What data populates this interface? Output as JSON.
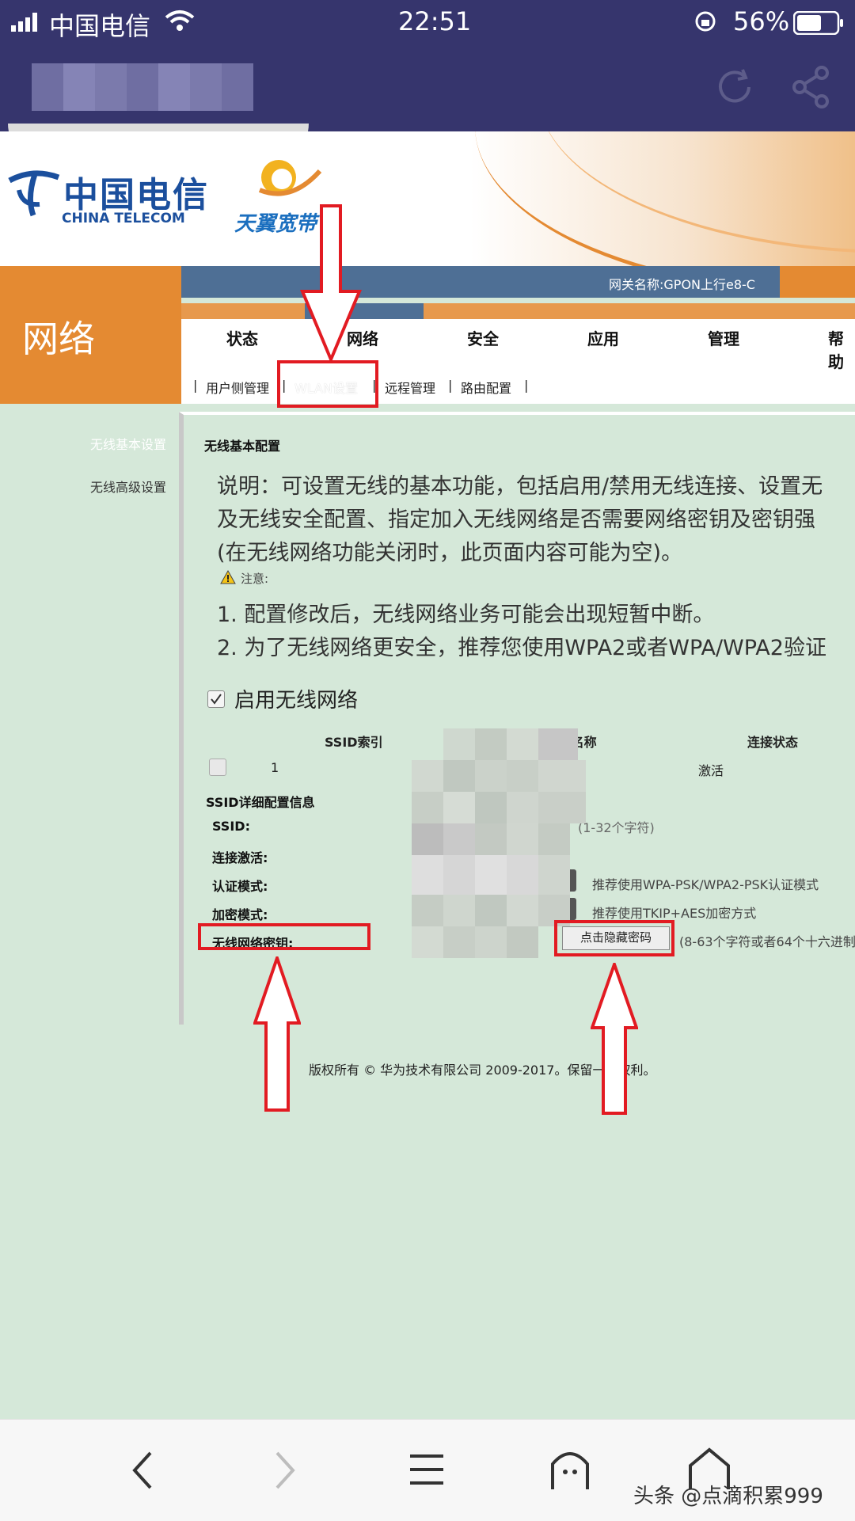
{
  "status_bar": {
    "carrier": "中国电信",
    "time": "22:51",
    "battery": "56%"
  },
  "router": {
    "brand_cn": "中国电信",
    "brand_en": "CHINA TELECOM",
    "sub_brand": "天翼宽带",
    "gateway_name": "网关名称:GPON上行e8-C",
    "section_title": "网络",
    "nav_tabs": [
      "状态",
      "网络",
      "安全",
      "应用",
      "管理",
      "帮助"
    ],
    "sub_nav": [
      "用户侧管理",
      "WLAN设置",
      "远程管理",
      "路由配置"
    ],
    "sub_sep": "|"
  },
  "sidebar": {
    "items": [
      "无线基本设置",
      "无线高级设置"
    ]
  },
  "content": {
    "section_title": "无线基本配置",
    "desc_lines": [
      "说明：可设置无线的基本功能，包括启用/禁用无线连接、设置无",
      "及无线安全配置、指定加入无线网络是否需要网络密钥及密钥强",
      "(在无线网络功能关闭时，此页面内容可能为空)。"
    ],
    "note_label": "注意:",
    "notes": [
      "1. 配置修改后，无线网络业务可能会出现短暂中断。",
      "2. 为了无线网络更安全，推荐您使用WPA2或者WPA/WPA2验证"
    ],
    "enable_wireless_label": "启用无线网络",
    "table_headers": [
      "SSID索引",
      "SSID名称",
      "连接状态"
    ],
    "table_row": {
      "index": "1",
      "status": "激活"
    },
    "ssid_detail_title": "SSID详细配置信息",
    "fields": [
      "SSID:",
      "连接激活:",
      "认证模式:",
      "加密模式:",
      "无线网络密钥:"
    ],
    "ssid_hint": "(1-32个字符)",
    "auth_hint": "推荐使用WPA-PSK/WPA2-PSK认证模式",
    "enc_hint": "推荐使用TKIP+AES加密方式",
    "hide_password_button": "点击隐藏密码",
    "key_hint": "(8-63个字符或者64个十六进制",
    "copyright": "版权所有 © 华为技术有限公司 2009-2017。保留一切权利。"
  },
  "watermark": "头条 @点滴积累999",
  "colors": {
    "header_purple": "#36356d",
    "orange": "#e48a32",
    "gateway_blue": "#4e6f95",
    "page_green": "#d5e8d9",
    "annotation_red": "#e21b22"
  }
}
